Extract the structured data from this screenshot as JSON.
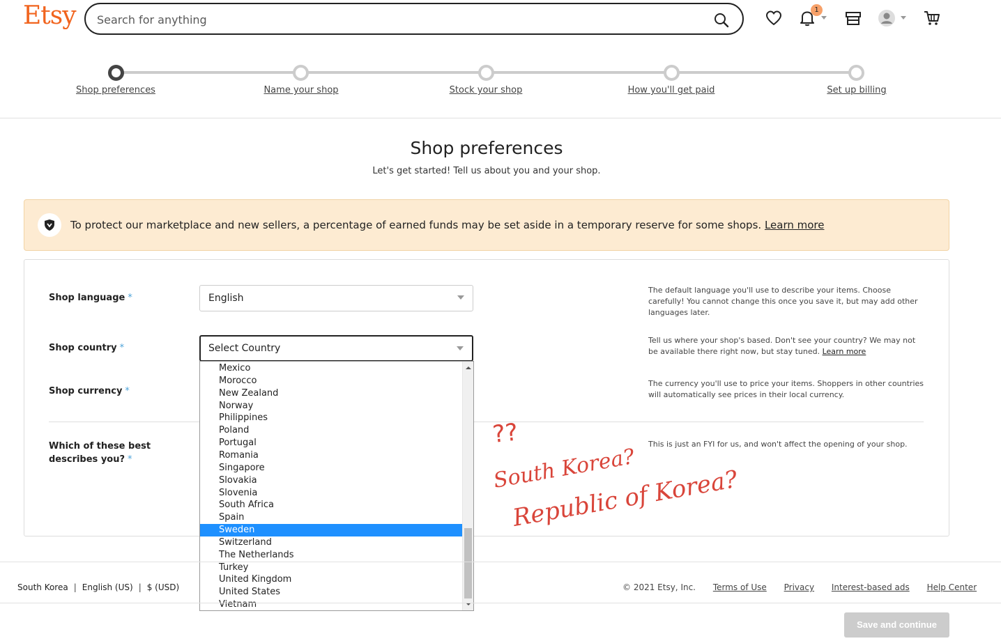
{
  "header": {
    "logo": "Etsy",
    "search_placeholder": "Search for anything",
    "notifications_count": "1"
  },
  "stepper": {
    "steps": [
      "Shop preferences",
      "Name your shop",
      "Stock your shop",
      "How you'll get paid",
      "Set up billing"
    ],
    "active_index": 0
  },
  "page": {
    "title": "Shop preferences",
    "subtitle": "Let's get started! Tell us about you and your shop."
  },
  "banner": {
    "text": "To protect our marketplace and new sellers, a percentage of earned funds may be set aside in a temporary reserve for some shops.",
    "link": "Learn more"
  },
  "form": {
    "language_label": "Shop language",
    "language_value": "English",
    "language_help": "The default language you'll use to describe your items. Choose carefully! You cannot change this once you save it, but may add other languages later.",
    "country_label": "Shop country",
    "country_value": "Select Country",
    "country_help": "Tell us where your shop's based. Don't see your country? We may not be available there right now, but stay tuned.",
    "country_help_link": "Learn more",
    "currency_label": "Shop currency",
    "currency_help": "The currency you'll use to price your items. Shoppers in other countries will automatically see prices in their local currency.",
    "describe_label_1": "Which of these best",
    "describe_label_2": "describes you?",
    "describe_help": "This is just an FYI for us, and won't affect the opening of your shop.",
    "required_mark": "*"
  },
  "dropdown": {
    "options": [
      "Mexico",
      "Morocco",
      "New Zealand",
      "Norway",
      "Philippines",
      "Poland",
      "Portugal",
      "Romania",
      "Singapore",
      "Slovakia",
      "Slovenia",
      "South Africa",
      "Spain",
      "Sweden",
      "Switzerland",
      "The Netherlands",
      "Turkey",
      "United Kingdom",
      "United States",
      "Vietnam"
    ],
    "highlighted": "Sweden"
  },
  "annotation": {
    "line1": "??",
    "line2": "South Korea?",
    "line3": "Republic of Korea?",
    "color": "#d9453a"
  },
  "footer": {
    "region": "South Korea",
    "language": "English (US)",
    "currency": "$ (USD)",
    "copyright": "© 2021 Etsy, Inc.",
    "links": [
      "Terms of Use",
      "Privacy",
      "Interest-based ads",
      "Help Center"
    ],
    "save_button": "Save and continue"
  }
}
